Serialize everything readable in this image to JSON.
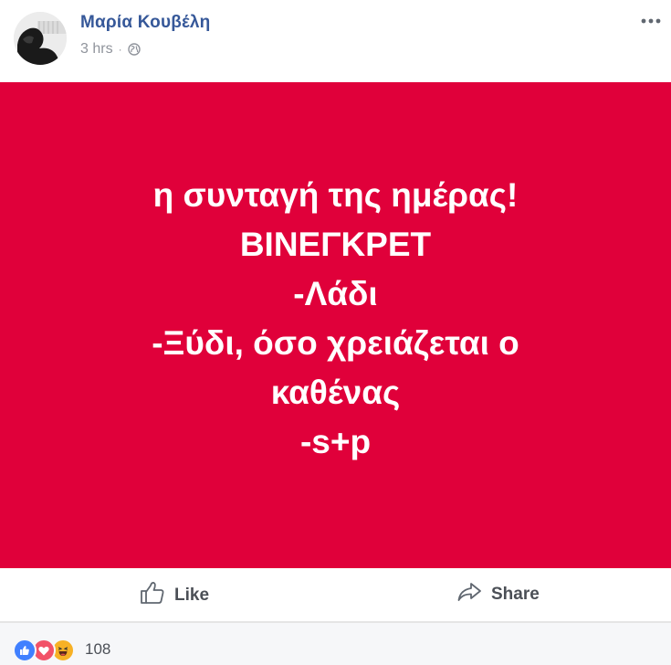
{
  "post": {
    "author_name": "Μαρία Κουβέλη",
    "timestamp": "3 hrs",
    "separator": "·",
    "privacy_icon": "globe-icon",
    "more_icon": "more-options-icon",
    "background_color": "#e0003a",
    "text_lines": [
      "η συνταγή της ημέρας!",
      "ΒΙΝΕΓΚΡΕΤ",
      "-Λάδι",
      "-Ξύδι, όσο χρειάζεται ο",
      "καθένας",
      "-s+p"
    ]
  },
  "actions": {
    "like_label": "Like",
    "like_icon": "thumbs-up-icon",
    "share_label": "Share",
    "share_icon": "share-arrow-icon"
  },
  "reactions": {
    "types": [
      "like",
      "love",
      "haha"
    ],
    "count": "108"
  },
  "colors": {
    "link": "#365899",
    "meta": "#90949c",
    "action_text": "#4b4f56"
  }
}
